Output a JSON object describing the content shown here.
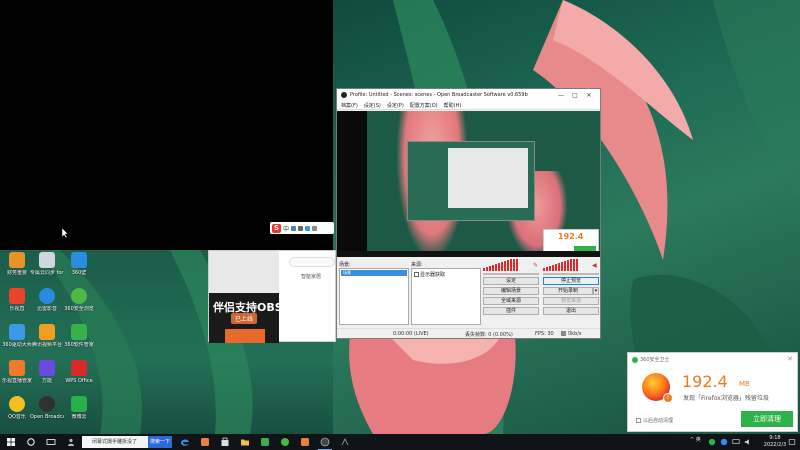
{
  "desktop": {
    "icons": [
      {
        "label": "财务重要",
        "color": "#e8922a"
      },
      {
        "label": "专属云同步 for 20210...",
        "color": "#cfd8e0"
      },
      {
        "label": "360壁",
        "color": "#2c8de0"
      },
      {
        "label": "乐视直",
        "color": "#e8452a"
      },
      {
        "label": "迅雷影音",
        "color": "#2a8ae0"
      },
      {
        "label": "360安全浏览",
        "color": "#4cb848"
      },
      {
        "label": "360驱动大师",
        "color": "#3a9ae8"
      },
      {
        "label": "腾讯视频平台",
        "color": "#f0a020"
      },
      {
        "label": "360软件管家",
        "color": "#3ab04a"
      },
      {
        "label": "乐视直播管家",
        "color": "#f07a2a"
      },
      {
        "label": "万能",
        "color": "#6a4ae0"
      },
      {
        "label": "WPS Office",
        "color": "#d92a2a"
      },
      {
        "label": "QQ音乐",
        "color": "#f0c020"
      },
      {
        "label": "Open Broadcast...",
        "color": "#303030"
      },
      {
        "label": "微博云",
        "color": "#2ab04a"
      }
    ]
  },
  "ime": {
    "logo": "S",
    "mode": "中"
  },
  "browser": {
    "banner_title": "伴侣支持OBS",
    "banner_sub": "已上线",
    "tab_text": "智能家居"
  },
  "obs": {
    "title": "Profile: Untitled - Scenes: scenes - Open Broadcaster Software v0.659b",
    "window_buttons": {
      "minimize": "—",
      "maximize": "□",
      "close": "✕"
    },
    "menu": [
      "档案(F)",
      "设定(S)",
      "设定(P)",
      "配置方案(O)",
      "帮助(H)"
    ],
    "scenes_label": "场景:",
    "scenes": [
      "场景"
    ],
    "sources_label": "来源:",
    "sources": [
      {
        "label": "显示器获取",
        "checked": true
      }
    ],
    "buttons": {
      "settings": "设定",
      "stop_preview": "停止预览",
      "edit_scene": "编辑场景",
      "start_record": "开始录制",
      "global_sources": "全域来源",
      "preview_stream": "预览串流",
      "plugins": "插件",
      "exit": "退出"
    },
    "status": {
      "time": "0:00:00 (LIVE)",
      "dropped": "丢失帧数: 0 (0.00%)",
      "fps": "FPS: 30",
      "kbps": "0kb/s"
    },
    "mini_popup_value": "192.4"
  },
  "popup": {
    "header": "360安全卫士",
    "close": "✕",
    "size_value": "192.4",
    "size_unit": "MB",
    "description": "发现「Firefox浏览器」残留垃圾",
    "checkbox_label": "以后自动清理",
    "clean_button": "立即清理",
    "colors": {
      "accent": "#f07a1c",
      "button": "#2fb24a"
    }
  },
  "taskbar": {
    "search_text": "闭幕式摄手雕拆没了",
    "search_button": "搜索一下",
    "tray_text": "^ 英",
    "clock_time": "9:18",
    "clock_date": "2022/2/3"
  }
}
